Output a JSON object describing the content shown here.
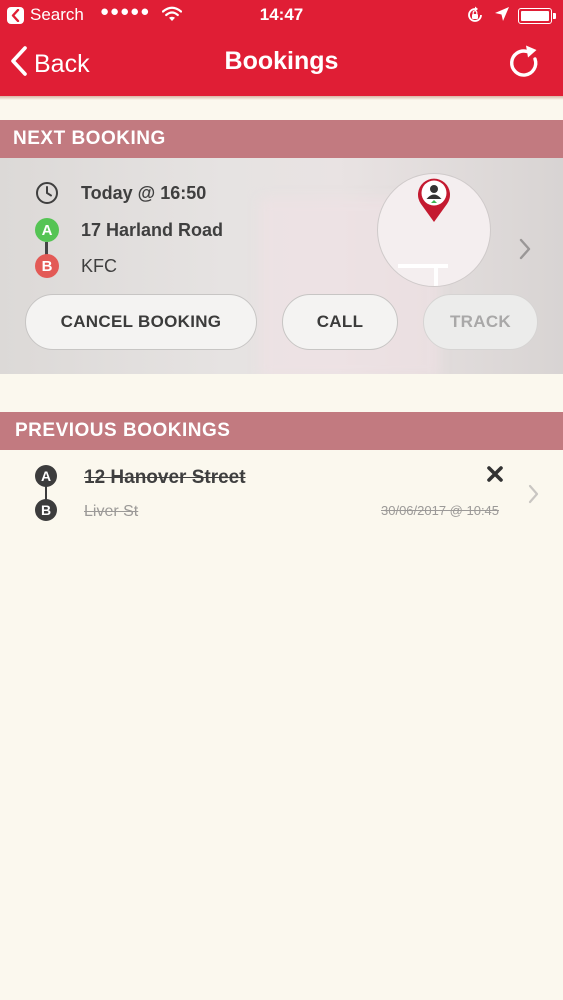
{
  "status_bar": {
    "back_app": "Search",
    "signal": "●●●●●",
    "time": "14:47"
  },
  "nav": {
    "back_label": "Back",
    "title": "Bookings",
    "refresh_icon": "refresh-icon"
  },
  "next_booking": {
    "header": "NEXT BOOKING",
    "time": "Today @ 16:50",
    "pickup_marker": "A",
    "pickup": "17 Harland Road",
    "dropoff_marker": "B",
    "dropoff": "KFC",
    "buttons": {
      "cancel": "CANCEL BOOKING",
      "call": "CALL",
      "track": "TRACK"
    }
  },
  "previous_bookings": {
    "header": "PREVIOUS BOOKINGS",
    "items": [
      {
        "pickup_marker": "A",
        "pickup": "12 Hanover Street",
        "dropoff_marker": "B",
        "dropoff": "Liver St",
        "datetime": "30/06/2017 @ 10:45",
        "status": "cancelled"
      }
    ]
  },
  "colors": {
    "brand_red": "#e01e35",
    "section_header": "#c27a80",
    "pickup_green": "#55c454",
    "dropoff_red": "#e35a56",
    "background": "#fbf8ee"
  }
}
